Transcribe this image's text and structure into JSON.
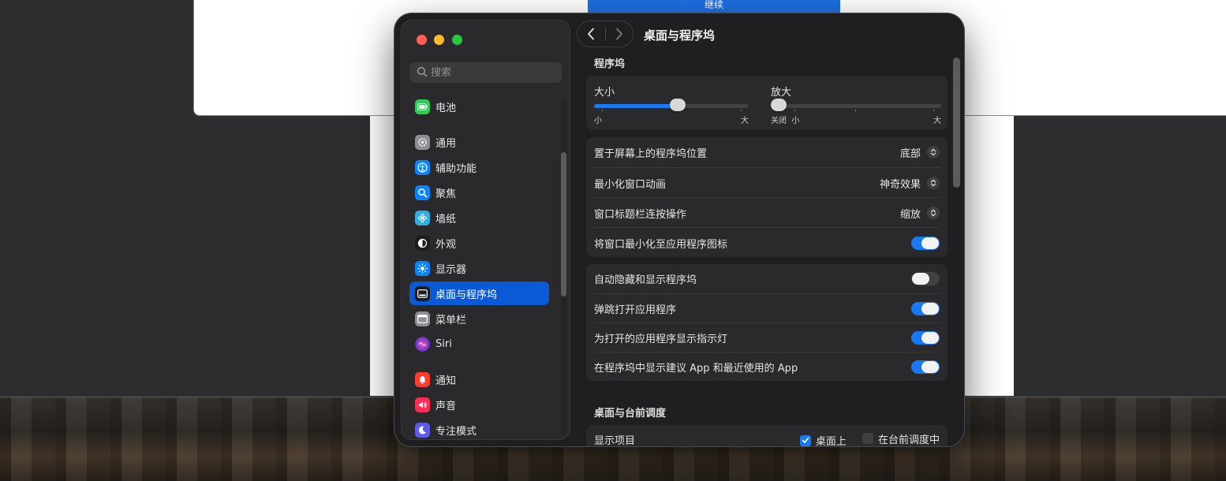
{
  "background": {
    "continue_button": "继续"
  },
  "sidebar": {
    "search_placeholder": "搜索",
    "items": [
      {
        "label": "电池",
        "icon": "battery-icon",
        "color": "#34c759"
      },
      {
        "label": "通用",
        "icon": "gear-icon",
        "color": "#8e8e93"
      },
      {
        "label": "辅助功能",
        "icon": "accessibility-icon",
        "color": "#0a84ff"
      },
      {
        "label": "聚焦",
        "icon": "spotlight-icon",
        "color": "#0a84ff"
      },
      {
        "label": "墙纸",
        "icon": "wallpaper-icon",
        "color": "#30b0e0"
      },
      {
        "label": "外观",
        "icon": "appearance-icon",
        "color": "#1c1c1e"
      },
      {
        "label": "显示器",
        "icon": "display-icon",
        "color": "#0a84ff"
      },
      {
        "label": "桌面与程序坞",
        "icon": "dock-icon",
        "color": "#1c1c1e"
      },
      {
        "label": "菜单栏",
        "icon": "menubar-icon",
        "color": "#8e8e93"
      },
      {
        "label": "Siri",
        "icon": "siri-icon",
        "color": "#7a3cd8"
      },
      {
        "label": "通知",
        "icon": "notifications-icon",
        "color": "#ff3b30"
      },
      {
        "label": "声音",
        "icon": "sound-icon",
        "color": "#ff2d55"
      },
      {
        "label": "专注模式",
        "icon": "focus-icon",
        "color": "#5e5ce6"
      }
    ],
    "active_index": 7
  },
  "main": {
    "title": "桌面与程序坞",
    "dock_section": "程序坞",
    "size_slider": {
      "label": "大小",
      "min_label": "小",
      "max_label": "大",
      "value": 0.54
    },
    "magnify_slider": {
      "label": "放大",
      "off_label": "关闭",
      "min_label": "小",
      "max_label": "大",
      "value": 0.0
    },
    "rows_group1": [
      {
        "label": "置于屏幕上的程序坞位置",
        "type": "popup",
        "value": "底部"
      },
      {
        "label": "最小化窗口动画",
        "type": "popup",
        "value": "神奇效果"
      },
      {
        "label": "窗口标题栏连按操作",
        "type": "popup",
        "value": "缩放"
      },
      {
        "label": "将窗口最小化至应用程序图标",
        "type": "toggle",
        "on": true
      }
    ],
    "rows_group2": [
      {
        "label": "自动隐藏和显示程序坞",
        "on": false
      },
      {
        "label": "弹跳打开应用程序",
        "on": true
      },
      {
        "label": "为打开的应用程序显示指示灯",
        "on": true
      },
      {
        "label": "在程序坞中显示建议 App 和最近使用的 App",
        "on": true
      }
    ],
    "stage_section": "桌面与台前调度",
    "show_items": {
      "label": "显示项目",
      "options": [
        {
          "label": "桌面上",
          "checked": true
        },
        {
          "label": "在台前调度中",
          "checked": false
        }
      ]
    }
  },
  "colors": {
    "accent": "#0a5ad8",
    "toggle_on": "#1a78f2"
  }
}
